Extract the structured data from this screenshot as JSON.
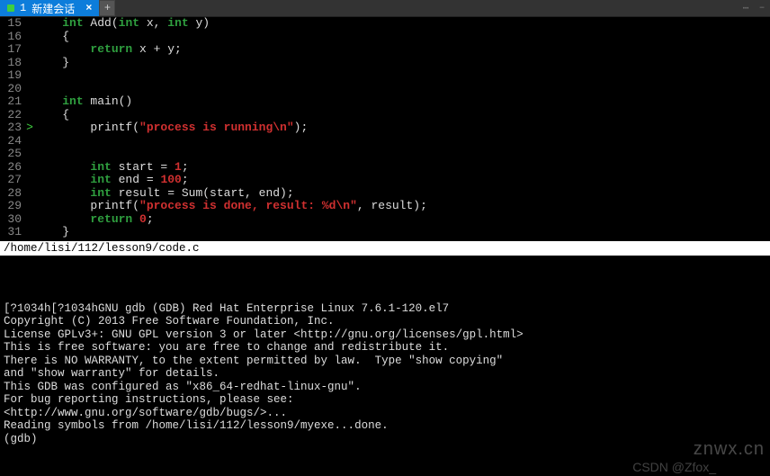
{
  "tab": {
    "index": "1",
    "title": "新建会话",
    "close": "×"
  },
  "newtab": "+",
  "code_lines": [
    {
      "n": 15,
      "bp": "",
      "tokens": [
        {
          "t": "    ",
          "c": ""
        },
        {
          "t": "int",
          "c": "kw"
        },
        {
          "t": " Add(",
          "c": ""
        },
        {
          "t": "int",
          "c": "kw"
        },
        {
          "t": " x, ",
          "c": ""
        },
        {
          "t": "int",
          "c": "kw"
        },
        {
          "t": " y)",
          "c": ""
        }
      ]
    },
    {
      "n": 16,
      "bp": "",
      "tokens": [
        {
          "t": "    {",
          "c": ""
        }
      ]
    },
    {
      "n": 17,
      "bp": "",
      "tokens": [
        {
          "t": "        ",
          "c": ""
        },
        {
          "t": "return",
          "c": "kw"
        },
        {
          "t": " x + y;",
          "c": ""
        }
      ]
    },
    {
      "n": 18,
      "bp": "",
      "tokens": [
        {
          "t": "    }",
          "c": ""
        }
      ]
    },
    {
      "n": 19,
      "bp": "",
      "tokens": []
    },
    {
      "n": 20,
      "bp": "",
      "tokens": []
    },
    {
      "n": 21,
      "bp": "",
      "tokens": [
        {
          "t": "    ",
          "c": ""
        },
        {
          "t": "int",
          "c": "kw"
        },
        {
          "t": " main()",
          "c": ""
        }
      ]
    },
    {
      "n": 22,
      "bp": "",
      "tokens": [
        {
          "t": "    {",
          "c": ""
        }
      ]
    },
    {
      "n": 23,
      "bp": ">",
      "tokens": [
        {
          "t": "        printf(",
          "c": ""
        },
        {
          "t": "\"process is running\\n\"",
          "c": "str"
        },
        {
          "t": ");",
          "c": ""
        }
      ]
    },
    {
      "n": 24,
      "bp": "",
      "tokens": []
    },
    {
      "n": 25,
      "bp": "",
      "tokens": []
    },
    {
      "n": 26,
      "bp": "",
      "tokens": [
        {
          "t": "        ",
          "c": ""
        },
        {
          "t": "int",
          "c": "kw"
        },
        {
          "t": " start = ",
          "c": ""
        },
        {
          "t": "1",
          "c": "num"
        },
        {
          "t": ";",
          "c": ""
        }
      ]
    },
    {
      "n": 27,
      "bp": "",
      "tokens": [
        {
          "t": "        ",
          "c": ""
        },
        {
          "t": "int",
          "c": "kw"
        },
        {
          "t": " end = ",
          "c": ""
        },
        {
          "t": "100",
          "c": "num"
        },
        {
          "t": ";",
          "c": ""
        }
      ]
    },
    {
      "n": 28,
      "bp": "",
      "tokens": [
        {
          "t": "        ",
          "c": ""
        },
        {
          "t": "int",
          "c": "kw"
        },
        {
          "t": " result = Sum(start, end);",
          "c": ""
        }
      ]
    },
    {
      "n": 29,
      "bp": "",
      "tokens": [
        {
          "t": "        printf(",
          "c": ""
        },
        {
          "t": "\"process is done, result: %d\\n\"",
          "c": "str"
        },
        {
          "t": ", result);",
          "c": ""
        }
      ]
    },
    {
      "n": 30,
      "bp": "",
      "tokens": [
        {
          "t": "        ",
          "c": ""
        },
        {
          "t": "return",
          "c": "kw"
        },
        {
          "t": " ",
          "c": ""
        },
        {
          "t": "0",
          "c": "num"
        },
        {
          "t": ";",
          "c": ""
        }
      ]
    },
    {
      "n": 31,
      "bp": "",
      "tokens": [
        {
          "t": "    }",
          "c": ""
        }
      ]
    }
  ],
  "path": "/home/lisi/112/lesson9/code.c",
  "terminal_lines": [
    "[?1034h[?1034hGNU gdb (GDB) Red Hat Enterprise Linux 7.6.1-120.el7",
    "Copyright (C) 2013 Free Software Foundation, Inc.",
    "License GPLv3+: GNU GPL version 3 or later <http://gnu.org/licenses/gpl.html>",
    "This is free software: you are free to change and redistribute it.",
    "There is NO WARRANTY, to the extent permitted by law.  Type \"show copying\"",
    "and \"show warranty\" for details.",
    "This GDB was configured as \"x86_64-redhat-linux-gnu\".",
    "For bug reporting instructions, please see:",
    "<http://www.gnu.org/software/gdb/bugs/>...",
    "Reading symbols from /home/lisi/112/lesson9/myexe...done.",
    "(gdb) "
  ],
  "watermark1": "znwx.cn",
  "watermark2": "CSDN @Zfox_"
}
